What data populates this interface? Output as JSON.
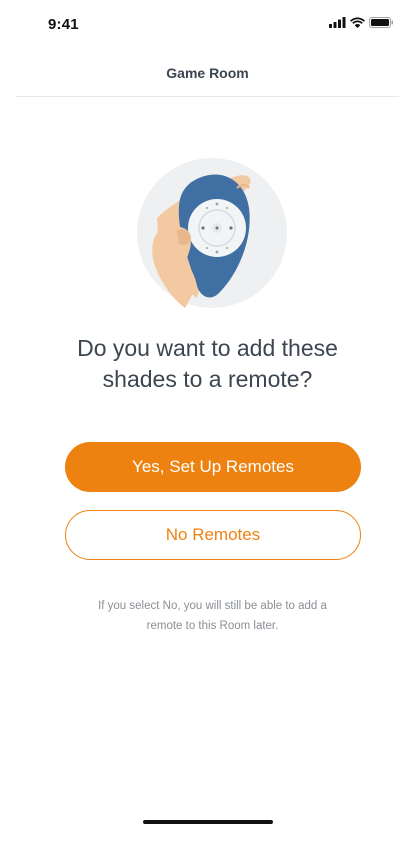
{
  "status_bar": {
    "time": "9:41"
  },
  "header": {
    "title": "Game Room"
  },
  "main": {
    "question_line1": "Do you want to add these",
    "question_line2": "shades to a remote?",
    "primary_button": "Yes, Set Up Remotes",
    "secondary_button": "No Remotes",
    "note_line1": "If you select No, you will still be able to add a",
    "note_line2": "remote to this Room later."
  },
  "colors": {
    "accent": "#ee8211",
    "text": "#3c4650",
    "muted": "#8a8f94",
    "remote_blue": "#3f6fa3"
  },
  "icons": [
    "signal-icon",
    "wifi-icon",
    "battery-icon",
    "remote-illustration"
  ]
}
